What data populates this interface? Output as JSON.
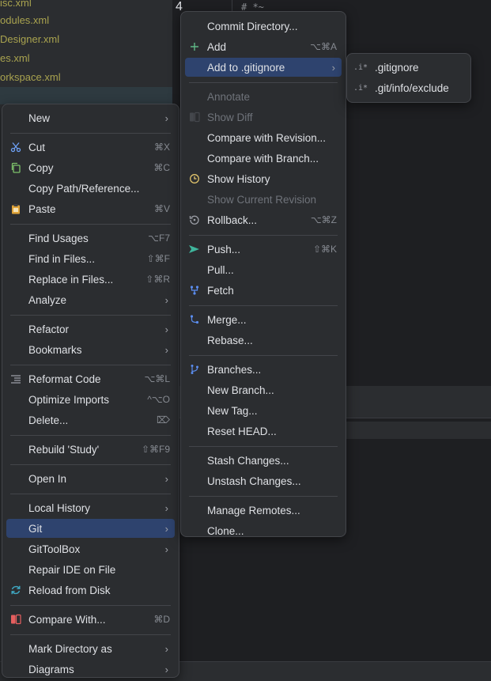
{
  "background": {
    "project_files": [
      "isc.xml",
      "odules.xml",
      "Designer.xml",
      "es.xml",
      "orkspace.xml"
    ],
    "editor_line_number": "4",
    "editor_text": "#_*~"
  },
  "context_menu": {
    "items": [
      {
        "label": "New",
        "shortcut": "",
        "submenu": true,
        "icon": ""
      },
      {
        "label": "Cut",
        "shortcut": "⌘X",
        "submenu": false,
        "icon": "scissors-icon"
      },
      {
        "label": "Copy",
        "shortcut": "⌘C",
        "submenu": false,
        "icon": "copy-icon"
      },
      {
        "label": "Copy Path/Reference...",
        "shortcut": "",
        "submenu": false,
        "icon": ""
      },
      {
        "label": "Paste",
        "shortcut": "⌘V",
        "submenu": false,
        "icon": "clipboard-icon"
      },
      {
        "label": "Find Usages",
        "shortcut": "⌥F7",
        "submenu": false,
        "icon": ""
      },
      {
        "label": "Find in Files...",
        "shortcut": "⇧⌘F",
        "submenu": false,
        "icon": ""
      },
      {
        "label": "Replace in Files...",
        "shortcut": "⇧⌘R",
        "submenu": false,
        "icon": ""
      },
      {
        "label": "Analyze",
        "shortcut": "",
        "submenu": true,
        "icon": ""
      },
      {
        "label": "Refactor",
        "shortcut": "",
        "submenu": true,
        "icon": ""
      },
      {
        "label": "Bookmarks",
        "shortcut": "",
        "submenu": true,
        "icon": ""
      },
      {
        "label": "Reformat Code",
        "shortcut": "⌥⌘L",
        "submenu": false,
        "icon": "reformat-icon"
      },
      {
        "label": "Optimize Imports",
        "shortcut": "^⌥O",
        "submenu": false,
        "icon": ""
      },
      {
        "label": "Delete...",
        "shortcut": "⌦",
        "submenu": false,
        "icon": ""
      },
      {
        "label": "Rebuild 'Study'",
        "shortcut": "⇧⌘F9",
        "submenu": false,
        "icon": ""
      },
      {
        "label": "Open In",
        "shortcut": "",
        "submenu": true,
        "icon": ""
      },
      {
        "label": "Local History",
        "shortcut": "",
        "submenu": true,
        "icon": ""
      },
      {
        "label": "Git",
        "shortcut": "",
        "submenu": true,
        "icon": ""
      },
      {
        "label": "GitToolBox",
        "shortcut": "",
        "submenu": true,
        "icon": ""
      },
      {
        "label": "Repair IDE on File",
        "shortcut": "",
        "submenu": false,
        "icon": ""
      },
      {
        "label": "Reload from Disk",
        "shortcut": "",
        "submenu": false,
        "icon": "reload-icon"
      },
      {
        "label": "Compare With...",
        "shortcut": "⌘D",
        "submenu": false,
        "icon": "compare-icon"
      },
      {
        "label": "Mark Directory as",
        "shortcut": "",
        "submenu": true,
        "icon": ""
      },
      {
        "label": "Diagrams",
        "shortcut": "",
        "submenu": true,
        "icon": ""
      }
    ],
    "selected": "Git"
  },
  "git_menu": {
    "items": [
      {
        "label": "Commit Directory...",
        "shortcut": "",
        "submenu": false,
        "disabled": false,
        "icon": ""
      },
      {
        "label": "Add",
        "shortcut": "⌥⌘A",
        "submenu": false,
        "disabled": false,
        "icon": "plus-icon"
      },
      {
        "label": "Add to .gitignore",
        "shortcut": "",
        "submenu": true,
        "disabled": false,
        "icon": ""
      },
      {
        "label": "Annotate",
        "shortcut": "",
        "submenu": false,
        "disabled": true,
        "icon": ""
      },
      {
        "label": "Show Diff",
        "shortcut": "",
        "submenu": false,
        "disabled": true,
        "icon": "diff-icon"
      },
      {
        "label": "Compare with Revision...",
        "shortcut": "",
        "submenu": false,
        "disabled": false,
        "icon": ""
      },
      {
        "label": "Compare with Branch...",
        "shortcut": "",
        "submenu": false,
        "disabled": false,
        "icon": ""
      },
      {
        "label": "Show History",
        "shortcut": "",
        "submenu": false,
        "disabled": false,
        "icon": "history-icon"
      },
      {
        "label": "Show Current Revision",
        "shortcut": "",
        "submenu": false,
        "disabled": true,
        "icon": ""
      },
      {
        "label": "Rollback...",
        "shortcut": "⌥⌘Z",
        "submenu": false,
        "disabled": false,
        "icon": "rollback-icon"
      },
      {
        "label": "Push...",
        "shortcut": "⇧⌘K",
        "submenu": false,
        "disabled": false,
        "icon": "push-icon"
      },
      {
        "label": "Pull...",
        "shortcut": "",
        "submenu": false,
        "disabled": false,
        "icon": ""
      },
      {
        "label": "Fetch",
        "shortcut": "",
        "submenu": false,
        "disabled": false,
        "icon": "fetch-icon"
      },
      {
        "label": "Merge...",
        "shortcut": "",
        "submenu": false,
        "disabled": false,
        "icon": "merge-icon"
      },
      {
        "label": "Rebase...",
        "shortcut": "",
        "submenu": false,
        "disabled": false,
        "icon": ""
      },
      {
        "label": "Branches...",
        "shortcut": "",
        "submenu": false,
        "disabled": false,
        "icon": "branch-icon"
      },
      {
        "label": "New Branch...",
        "shortcut": "",
        "submenu": false,
        "disabled": false,
        "icon": ""
      },
      {
        "label": "New Tag...",
        "shortcut": "",
        "submenu": false,
        "disabled": false,
        "icon": ""
      },
      {
        "label": "Reset HEAD...",
        "shortcut": "",
        "submenu": false,
        "disabled": false,
        "icon": ""
      },
      {
        "label": "Stash Changes...",
        "shortcut": "",
        "submenu": false,
        "disabled": false,
        "icon": ""
      },
      {
        "label": "Unstash Changes...",
        "shortcut": "",
        "submenu": false,
        "disabled": false,
        "icon": ""
      },
      {
        "label": "Manage Remotes...",
        "shortcut": "",
        "submenu": false,
        "disabled": false,
        "icon": ""
      },
      {
        "label": "Clone...",
        "shortcut": "",
        "submenu": false,
        "disabled": false,
        "icon": ""
      }
    ],
    "selected": "Add to .gitignore"
  },
  "gitignore_submenu": {
    "items": [
      {
        "label": ".gitignore",
        "icon": "gitignore-file-icon"
      },
      {
        "label": ".git/info/exclude",
        "icon": "gitignore-file-icon"
      }
    ]
  },
  "colors": {
    "menu_bg": "#2b2d30",
    "selection": "#2e436e",
    "disabled_text": "#6f737a",
    "file_modified": "#a9a34f"
  }
}
